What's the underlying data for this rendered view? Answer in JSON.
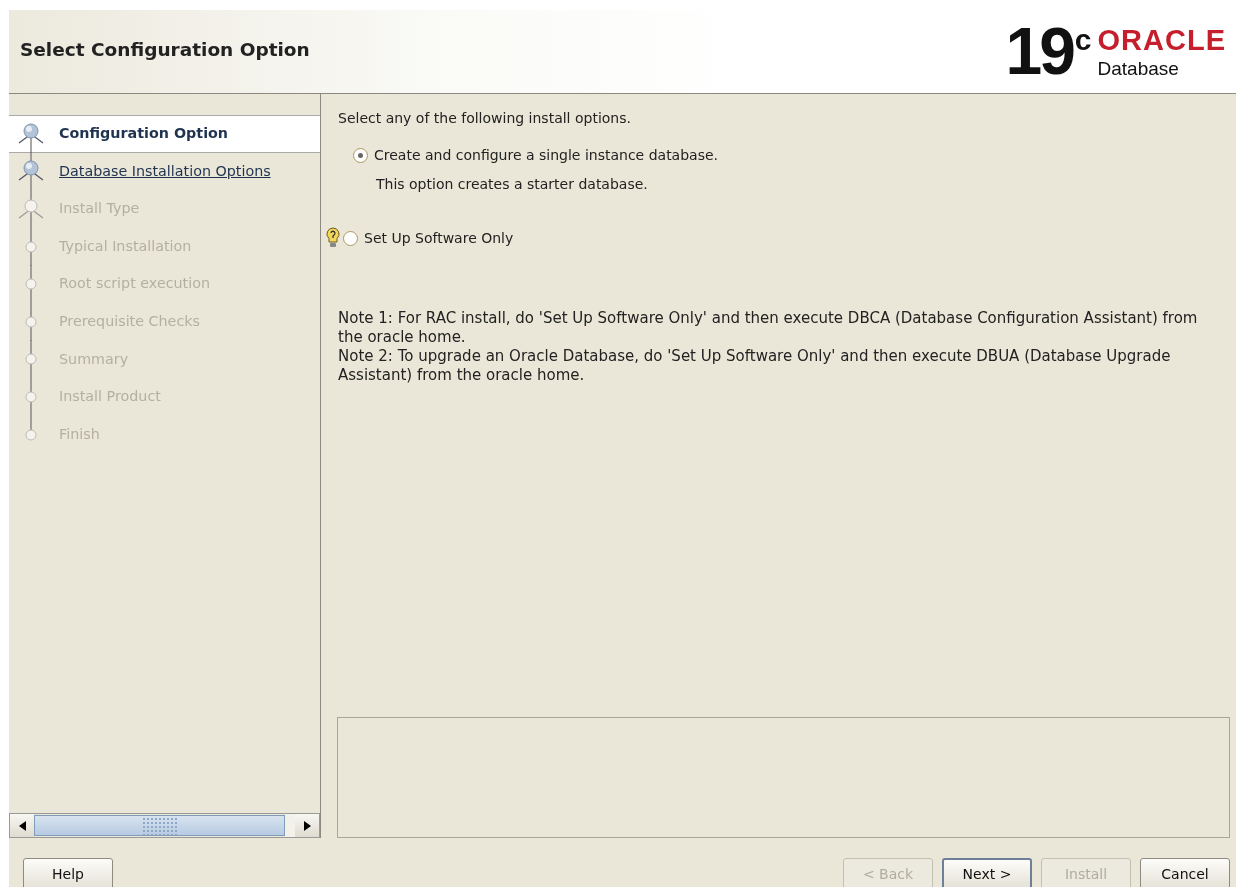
{
  "header": {
    "title": "Select Configuration Option",
    "logo": {
      "version": "19",
      "superscript": "c",
      "brand": "ORACLE",
      "product": "Database"
    }
  },
  "steps": [
    {
      "label": "Configuration Option",
      "selected": true,
      "disabled": false
    },
    {
      "label": "Database Installation Options",
      "selected": false,
      "disabled": false
    },
    {
      "label": "Install Type",
      "selected": false,
      "disabled": true
    },
    {
      "label": "Typical Installation",
      "selected": false,
      "disabled": true
    },
    {
      "label": "Root script execution",
      "selected": false,
      "disabled": true
    },
    {
      "label": "Prerequisite Checks",
      "selected": false,
      "disabled": true
    },
    {
      "label": "Summary",
      "selected": false,
      "disabled": true
    },
    {
      "label": "Install Product",
      "selected": false,
      "disabled": true
    },
    {
      "label": "Finish",
      "selected": false,
      "disabled": true
    }
  ],
  "content": {
    "prompt": "Select any of the following install options.",
    "options": [
      {
        "label": "Create and configure a single instance database.",
        "selected": true,
        "description": "This option creates a starter database.",
        "help": false
      },
      {
        "label": "Set Up Software Only",
        "selected": false,
        "help": true
      }
    ],
    "notes": [
      "Note 1: For RAC install, do 'Set Up Software Only' and then execute DBCA (Database Configuration Assistant) from the oracle home.",
      "Note 2: To upgrade an Oracle Database, do 'Set Up Software Only' and then execute DBUA (Database Upgrade Assistant) from the oracle home."
    ]
  },
  "buttons": {
    "left": [
      {
        "label": "Help",
        "disabled": false,
        "default": false
      }
    ],
    "right": [
      {
        "label": "< Back",
        "disabled": true,
        "default": false
      },
      {
        "label": "Next >",
        "disabled": false,
        "default": true
      },
      {
        "label": "Install",
        "disabled": true,
        "default": false
      },
      {
        "label": "Cancel",
        "disabled": false,
        "default": false
      }
    ]
  }
}
